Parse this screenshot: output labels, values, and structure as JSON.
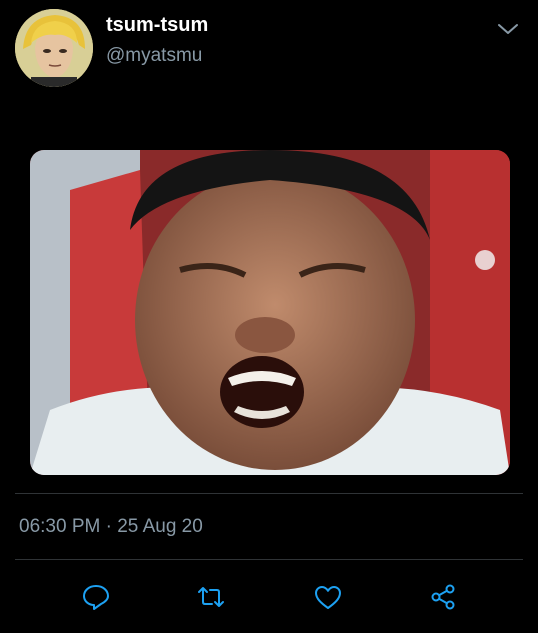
{
  "tweet": {
    "display_name": "tsum-tsum",
    "handle": "@myatsmu",
    "timestamp": "06:30 PM · 25 Aug 20"
  },
  "icons": {
    "menu": "chevron-down-icon",
    "reply": "reply-icon",
    "retweet": "retweet-icon",
    "like": "heart-icon",
    "share": "share-icon"
  },
  "colors": {
    "background": "#000000",
    "primary_text": "#ffffff",
    "secondary_text": "#8899a6",
    "icon": "#1da1f2",
    "divider": "#2f3336"
  }
}
